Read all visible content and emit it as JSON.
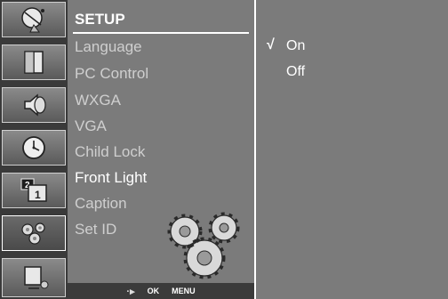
{
  "sidebar": {
    "items": [
      {
        "name": "satellite-dish-icon"
      },
      {
        "name": "picture-icon"
      },
      {
        "name": "sound-icon"
      },
      {
        "name": "clock-icon"
      },
      {
        "name": "pip-icon"
      },
      {
        "name": "setup-gears-icon"
      },
      {
        "name": "pc-input-icon"
      }
    ],
    "active_index": 5,
    "pip_number": "2",
    "pip_inner_number": "1"
  },
  "menu": {
    "title": "SETUP",
    "items": [
      {
        "label": "Language"
      },
      {
        "label": "PC Control"
      },
      {
        "label": "WXGA"
      },
      {
        "label": "VGA"
      },
      {
        "label": "Child Lock"
      },
      {
        "label": "Front Light"
      },
      {
        "label": "Caption"
      },
      {
        "label": "Set ID"
      }
    ],
    "current_index": 5
  },
  "footer": {
    "nav_symbol": "·▸",
    "ok_label": "OK",
    "menu_label": "MENU"
  },
  "options": {
    "check_symbol": "√",
    "items": [
      {
        "label": "On",
        "selected": true
      },
      {
        "label": "Off",
        "selected": false
      }
    ]
  },
  "colors": {
    "panel": "#7b7b7b",
    "sidebar": "#3a3a3a",
    "text_active": "#ffffff",
    "text_inactive": "#cfcfcf"
  }
}
